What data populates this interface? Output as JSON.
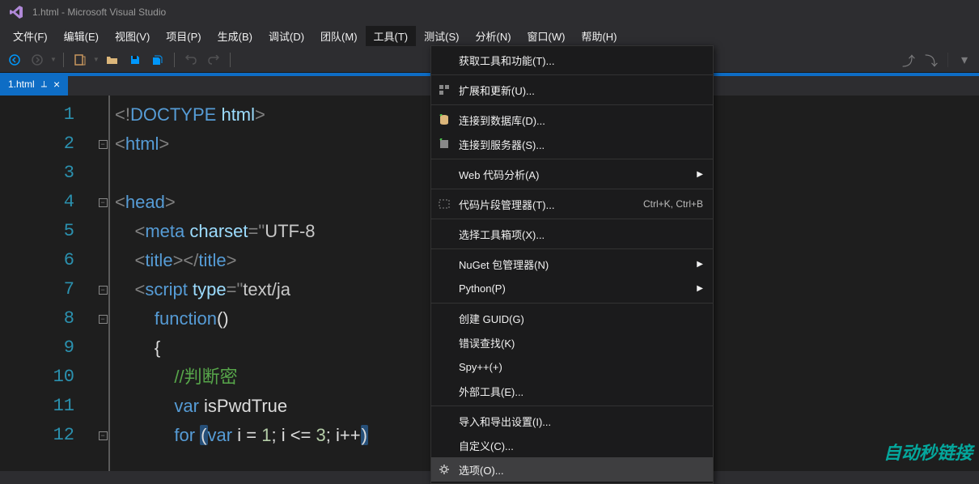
{
  "titlebar": {
    "text": "1.html - Microsoft Visual Studio"
  },
  "menubar": {
    "items": [
      "文件(F)",
      "编辑(E)",
      "视图(V)",
      "项目(P)",
      "生成(B)",
      "调试(D)",
      "团队(M)",
      "工具(T)",
      "测试(S)",
      "分析(N)",
      "窗口(W)",
      "帮助(H)"
    ],
    "active_index": 7
  },
  "tab": {
    "name": "1.html"
  },
  "code": {
    "lines": [
      {
        "n": 1,
        "html": "<span class='c-punc'>&lt;!</span><span class='c-tag'>DOCTYPE</span> <span class='c-attr'>html</span><span class='c-punc'>&gt;</span>"
      },
      {
        "n": 2,
        "fold": "-",
        "html": "<span class='c-punc'>&lt;</span><span class='c-tag'>html</span><span class='c-punc'>&gt;</span>"
      },
      {
        "n": 3,
        "html": ""
      },
      {
        "n": 4,
        "fold": "-",
        "html": "<span class='c-punc'>&lt;</span><span class='c-tag'>head</span><span class='c-punc'>&gt;</span>"
      },
      {
        "n": 5,
        "html": "    <span class='c-punc'>&lt;</span><span class='c-tag'>meta</span> <span class='c-attr'>charset</span><span class='c-punc'>=</span><span class='c-punc'>\"</span><span class='c-str'>UTF-8</span>"
      },
      {
        "n": 6,
        "html": "    <span class='c-punc'>&lt;</span><span class='c-tag'>title</span><span class='c-punc'>&gt;&lt;/</span><span class='c-tag'>title</span><span class='c-punc'>&gt;</span>"
      },
      {
        "n": 7,
        "fold": "-",
        "html": "    <span class='c-punc'>&lt;</span><span class='c-tag'>script</span> <span class='c-attr'>type</span><span class='c-punc'>=</span><span class='c-punc'>\"</span><span class='c-str'>text/ja</span>"
      },
      {
        "n": 8,
        "fold": "-",
        "html": "        <span class='c-kw'>function</span><span class='c-text'>()</span>"
      },
      {
        "n": 9,
        "html": "        <span class='c-text'>{</span>"
      },
      {
        "n": 10,
        "html": "            <span class='c-comment'>//判断密</span>"
      },
      {
        "n": 11,
        "html": "            <span class='c-kw'>var</span> <span class='c-ident'>isPwdTrue</span>"
      },
      {
        "n": 12,
        "fold": "-",
        "html": "            <span class='c-kw'>for</span> <span class='hl-paren c-text'>(</span><span class='c-kw'>var</span> <span class='c-ident'>i</span> <span class='c-op'>=</span> <span class='c-num'>1</span><span class='c-text'>;</span> <span class='c-ident'>i</span> <span class='c-op'>&lt;=</span> <span class='c-num'>3</span><span class='c-text'>;</span> <span class='c-ident'>i</span><span class='c-op'>++</span><span class='hl-paren c-text'>)</span>"
      }
    ]
  },
  "dropdown": {
    "items": [
      {
        "label": "获取工具和功能(T)...",
        "icon": ""
      },
      {
        "sep": true
      },
      {
        "label": "扩展和更新(U)...",
        "icon": "extensions"
      },
      {
        "sep": true
      },
      {
        "label": "连接到数据库(D)...",
        "icon": "database"
      },
      {
        "label": "连接到服务器(S)...",
        "icon": "server"
      },
      {
        "sep": true
      },
      {
        "label": "Web 代码分析(A)",
        "submenu": true
      },
      {
        "sep": true
      },
      {
        "label": "代码片段管理器(T)...",
        "icon": "snippet",
        "shortcut": "Ctrl+K, Ctrl+B"
      },
      {
        "sep": true
      },
      {
        "label": "选择工具箱项(X)..."
      },
      {
        "sep": true
      },
      {
        "label": "NuGet 包管理器(N)",
        "submenu": true
      },
      {
        "label": "Python(P)",
        "submenu": true
      },
      {
        "sep": true
      },
      {
        "label": "创建 GUID(G)"
      },
      {
        "label": "错误查找(K)"
      },
      {
        "label": "Spy++(+)"
      },
      {
        "label": "外部工具(E)..."
      },
      {
        "sep": true
      },
      {
        "label": "导入和导出设置(I)..."
      },
      {
        "label": "自定义(C)..."
      },
      {
        "label": "选项(O)...",
        "icon": "gear",
        "hover": true
      }
    ]
  },
  "watermark": {
    "main": "自动秒链接",
    "sub": ""
  }
}
